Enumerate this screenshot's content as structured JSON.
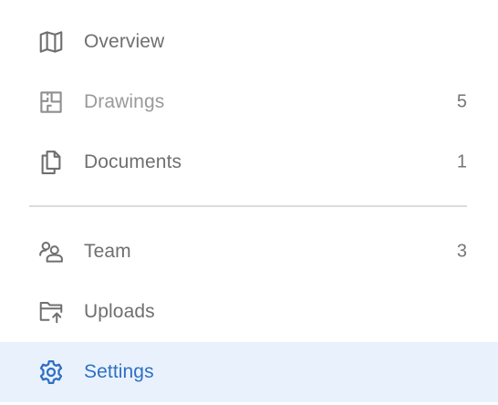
{
  "nav": {
    "primary": [
      {
        "label": "Overview",
        "count": null,
        "icon": "map-icon",
        "state": "normal"
      },
      {
        "label": "Drawings",
        "count": "5",
        "icon": "floorplan-icon",
        "state": "muted"
      },
      {
        "label": "Documents",
        "count": "1",
        "icon": "documents-icon",
        "state": "normal"
      }
    ],
    "secondary": [
      {
        "label": "Team",
        "count": "3",
        "icon": "team-icon",
        "state": "normal"
      },
      {
        "label": "Uploads",
        "count": null,
        "icon": "upload-folder-icon",
        "state": "normal"
      },
      {
        "label": "Settings",
        "count": null,
        "icon": "gear-icon",
        "state": "active"
      }
    ]
  },
  "colors": {
    "text": "#6f6f6f",
    "muted_text": "#9a9a9a",
    "active_text": "#2f6fc4",
    "active_bg": "#e9f2fc",
    "divider": "#dcdcdc"
  }
}
